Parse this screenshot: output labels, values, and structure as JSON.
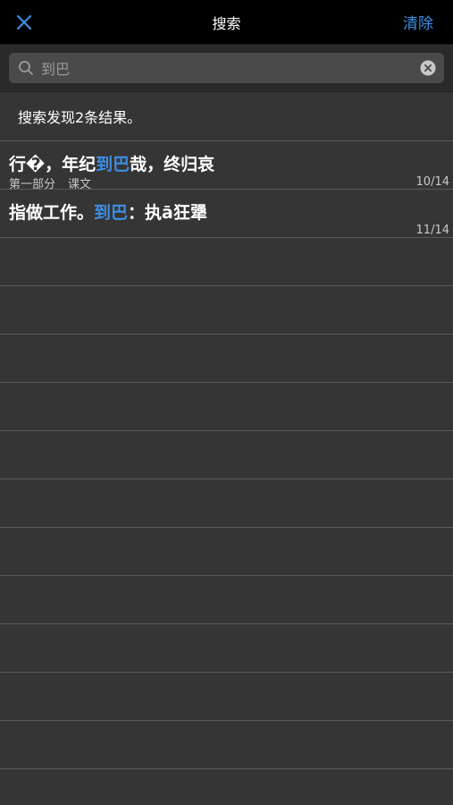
{
  "navbar": {
    "title": "搜索",
    "clear_label": "清除"
  },
  "search": {
    "value": "到巴",
    "placeholder": ""
  },
  "summary": {
    "text": "搜索发现2条结果。"
  },
  "results": [
    {
      "title_before": "行�，年纪",
      "title_match": "到巴",
      "title_after": "哉，终归哀",
      "section": "第一部分",
      "category": "课文",
      "page": "10/14"
    },
    {
      "title_before": "指做工作。",
      "title_match": "到巴",
      "title_after": "：执ā狂犟",
      "section": "",
      "category": "",
      "page": "11/14"
    }
  ],
  "colors": {
    "accent": "#3d8fe6",
    "background": "#353535",
    "navbar": "#000000"
  },
  "icons": {
    "close": "close-icon",
    "search": "search-icon",
    "clear_input": "clear-input-icon"
  }
}
